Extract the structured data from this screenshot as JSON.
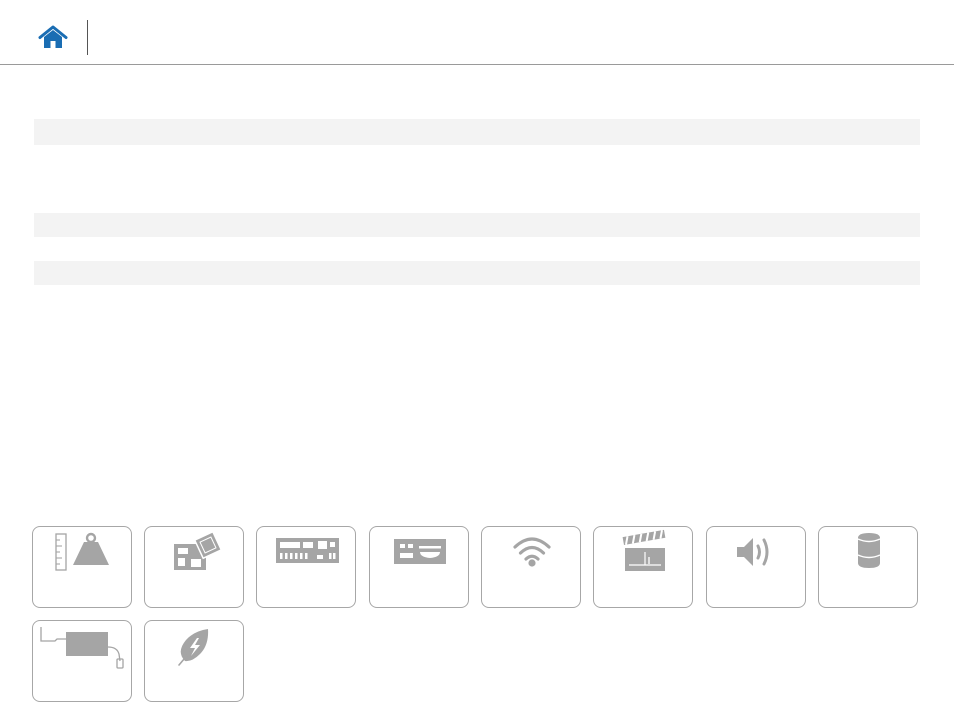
{
  "header": {
    "home_icon": "home-icon"
  },
  "colors": {
    "accent": "#1a6db3",
    "icon_gray": "#a5a5a5",
    "band": "#f3f3f3"
  },
  "tiles": [
    {
      "icon": "weight-dimensions-icon"
    },
    {
      "icon": "motherboard-icon"
    },
    {
      "icon": "rear-panel-ports-icon"
    },
    {
      "icon": "front-panel-ports-icon"
    },
    {
      "icon": "wireless-icon"
    },
    {
      "icon": "video-clapper-icon"
    },
    {
      "icon": "audio-speaker-icon"
    },
    {
      "icon": "storage-drive-icon"
    },
    {
      "icon": "power-adapter-icon"
    },
    {
      "icon": "eco-leaf-icon"
    }
  ]
}
